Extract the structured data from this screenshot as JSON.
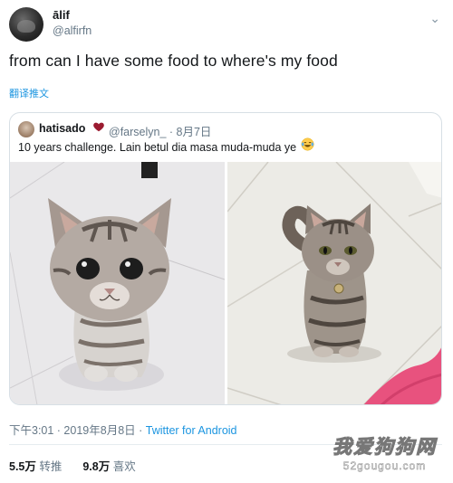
{
  "tweet": {
    "name": "ālif",
    "handle": "@alfirfn",
    "text": "from can I have some food to where's my food",
    "translate_label": "翻译推文",
    "menu_icon": "chevron-down-icon"
  },
  "quoted": {
    "name": "hatisado",
    "handle_date": "@farselyn_ · 8月7日",
    "text": "10 years challenge. Lain betul dia masa muda-muda ye",
    "heart_color": "#9b1b30",
    "emoji_icon": "laughing-tears-emoji-icon",
    "images": [
      {
        "name": "kitten-photo",
        "icon": "kitten-photo-image"
      },
      {
        "name": "grown-cat-photo",
        "icon": "grown-cat-photo-image"
      }
    ]
  },
  "footer": {
    "time": "下午3:01 · 2019年8月8日 · ",
    "source": "Twitter for Android"
  },
  "stats": {
    "retweets_count": "5.5万",
    "retweets_label": "转推",
    "likes_count": "9.8万",
    "likes_label": "喜欢"
  },
  "watermark": {
    "line1": "我爱狗狗网",
    "line2": "52gougou.com"
  },
  "colors": {
    "link": "#1b95e0",
    "muted": "#657786",
    "border": "#d7dfe5"
  }
}
